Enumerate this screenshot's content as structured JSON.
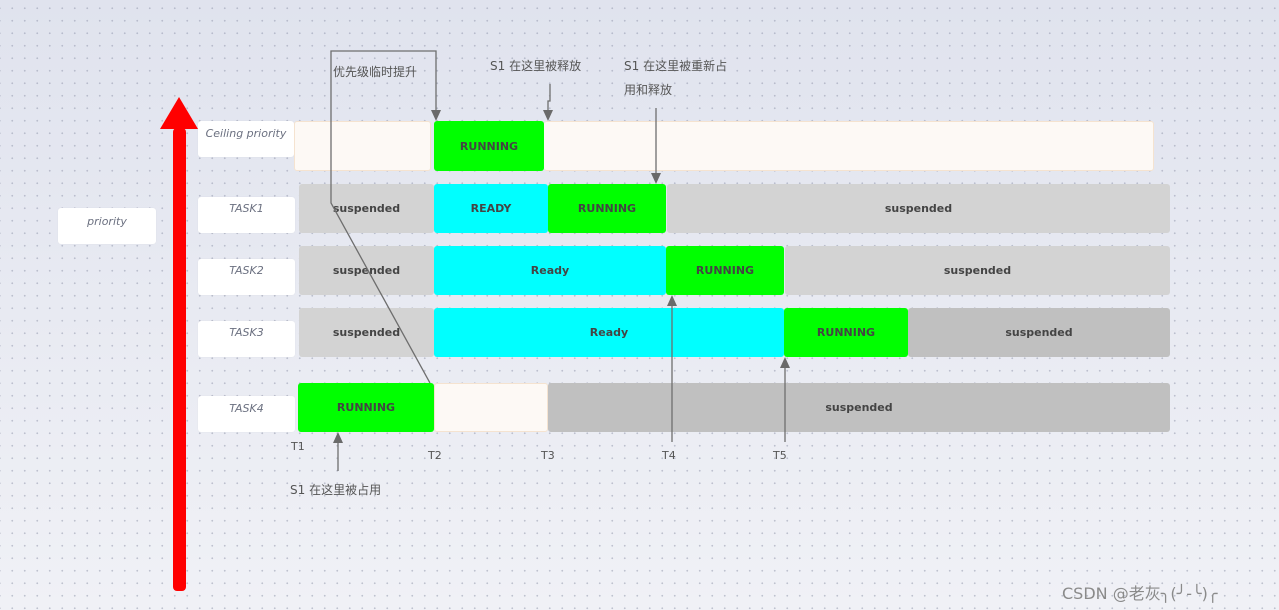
{
  "axis": {
    "label": "priority",
    "arrow_color": "#ff0000"
  },
  "rows": [
    {
      "key": "ceiling",
      "label": "Ceiling priority",
      "segments": [
        {
          "state": "",
          "color": "#fdf9f5"
        },
        {
          "state": "RUNNING",
          "color": "#00ff00"
        },
        {
          "state": "",
          "color": "#fdf9f5"
        }
      ]
    },
    {
      "key": "task1",
      "label": "TASK1",
      "segments": [
        {
          "state": "suspended",
          "color": "#d3d3d3"
        },
        {
          "state": "READY",
          "color": "#00ffff"
        },
        {
          "state": "RUNNING",
          "color": "#00ff00"
        },
        {
          "state": "suspended",
          "color": "#d3d3d3"
        }
      ]
    },
    {
      "key": "task2",
      "label": "TASK2",
      "segments": [
        {
          "state": "suspended",
          "color": "#d3d3d3"
        },
        {
          "state": "Ready",
          "color": "#00ffff"
        },
        {
          "state": "RUNNING",
          "color": "#00ff00"
        },
        {
          "state": "suspended",
          "color": "#d3d3d3"
        }
      ]
    },
    {
      "key": "task3",
      "label": "TASK3",
      "segments": [
        {
          "state": "suspended",
          "color": "#d3d3d3"
        },
        {
          "state": "Ready",
          "color": "#00ffff"
        },
        {
          "state": "RUNNING",
          "color": "#00ff00"
        },
        {
          "state": "suspended",
          "color": "#c0c0c0"
        }
      ]
    },
    {
      "key": "task4",
      "label": "TASK4",
      "segments": [
        {
          "state": "RUNNING",
          "color": "#00ff00"
        },
        {
          "state": "",
          "color": "#fdf9f5"
        },
        {
          "state": "suspended",
          "color": "#c0c0c0"
        }
      ]
    }
  ],
  "time_marks": [
    "T1",
    "T2",
    "T3",
    "T4",
    "T5"
  ],
  "annotations": {
    "priority_boost": "优先级临时提升",
    "s1_released": "S1 在这里被释放",
    "s1_reacquired_line1": "S1 在这里被重新占",
    "s1_reacquired_line2": "用和释放",
    "s1_acquired": "S1 在这里被占用"
  },
  "watermark": "CSDN @老灰╮(╯-╰)╭"
}
